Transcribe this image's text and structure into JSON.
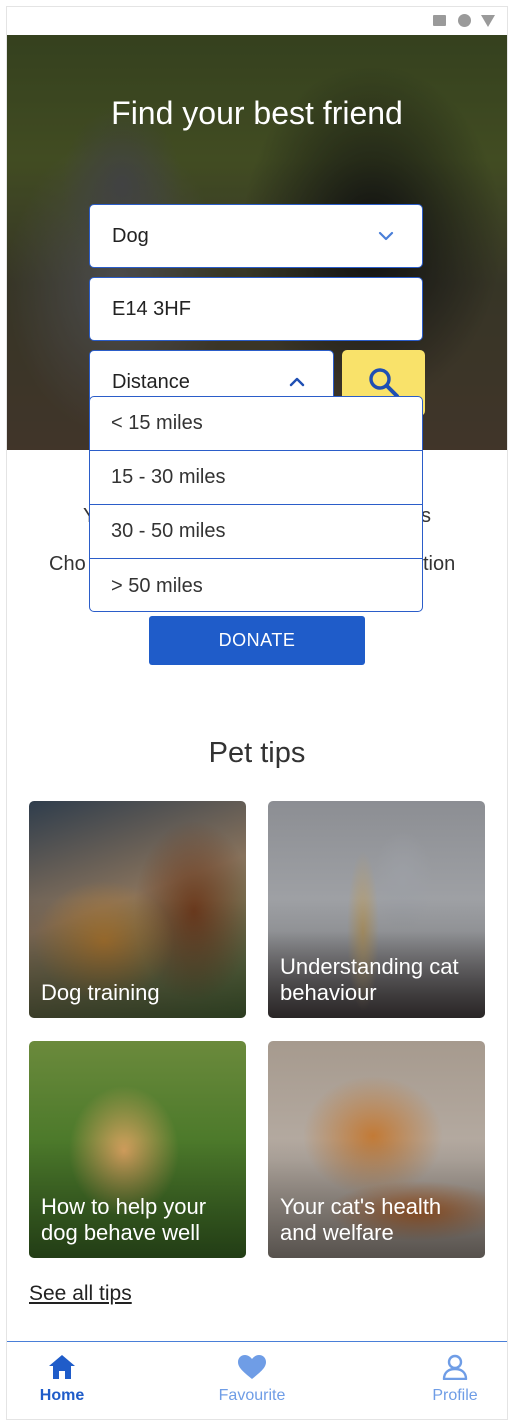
{
  "hero": {
    "title": "Find your best friend",
    "species_value": "Dog",
    "postcode_value": "E14 3HF",
    "distance_label": "Distance"
  },
  "distance_options": [
    "< 15 miles",
    "15 - 30 miles",
    "30 - 50 miles",
    "> 50 miles"
  ],
  "mission": {
    "line1_left": "Y",
    "line1_right": "s",
    "line2_left": "Cho",
    "line2_right": "tion",
    "donate_label": "DONATE"
  },
  "tips": {
    "title": "Pet tips",
    "cards": [
      {
        "label": "Dog training"
      },
      {
        "label": "Understanding cat behaviour"
      },
      {
        "label": "How to help your dog behave well"
      },
      {
        "label": "Your cat's health and welfare"
      }
    ],
    "see_all": "See all tips"
  },
  "nav": {
    "home": "Home",
    "favourite": "Favourite",
    "profile": "Profile"
  },
  "colors": {
    "primary": "#1f5cc9",
    "search_button": "#f9e26a",
    "nav_inactive": "#6f9de6"
  }
}
